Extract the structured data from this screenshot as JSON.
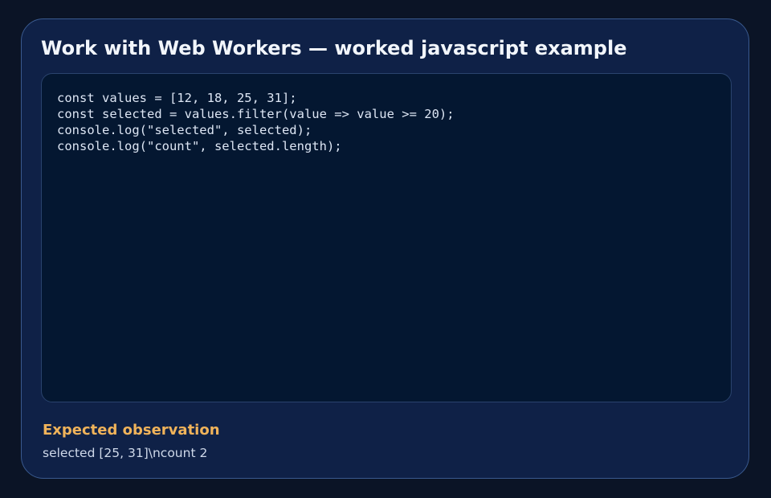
{
  "card": {
    "title": "Work with Web Workers — worked javascript example"
  },
  "code": {
    "lines": [
      "const values = [12, 18, 25, 31];",
      "const selected = values.filter(value => value >= 20);",
      "console.log(\"selected\", selected);",
      "console.log(\"count\", selected.length);"
    ]
  },
  "observation": {
    "heading": "Expected observation",
    "text": "selected [25, 31]\\ncount 2"
  },
  "colors": {
    "background": "#0b1426",
    "card": "#0f2147",
    "code_panel": "#041731",
    "accent": "#f0b35a"
  }
}
